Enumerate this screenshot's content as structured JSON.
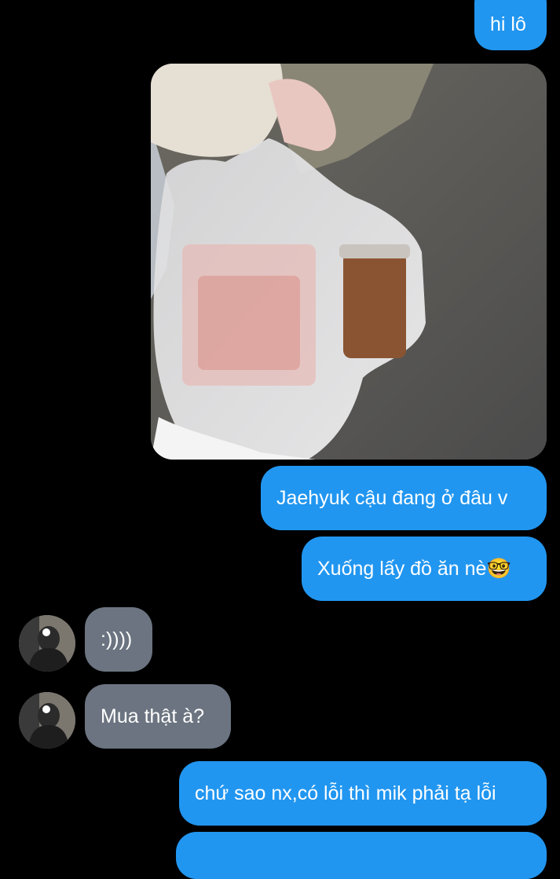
{
  "messages": [
    {
      "side": "sent",
      "text": "hi lô"
    },
    {
      "side": "sent",
      "type": "image",
      "image_icon": "photo-of-takeout-bag-icon"
    },
    {
      "side": "sent",
      "text": "Jaehyuk cậu đang ở đâu v"
    },
    {
      "side": "sent",
      "text": "Xuống lấy đồ ăn nè🤓"
    },
    {
      "side": "received",
      "text": ":))))"
    },
    {
      "side": "received",
      "text": "Mua thật à?"
    },
    {
      "side": "sent",
      "text": "chứ sao nx,có lỗi thì mik phải tạ lỗi"
    }
  ],
  "colors": {
    "background": "#000000",
    "sent_bubble": "#2196f0",
    "received_bubble": "#6b7480",
    "text": "#ffffff"
  },
  "icons": {
    "avatar": "avatar-icon"
  }
}
